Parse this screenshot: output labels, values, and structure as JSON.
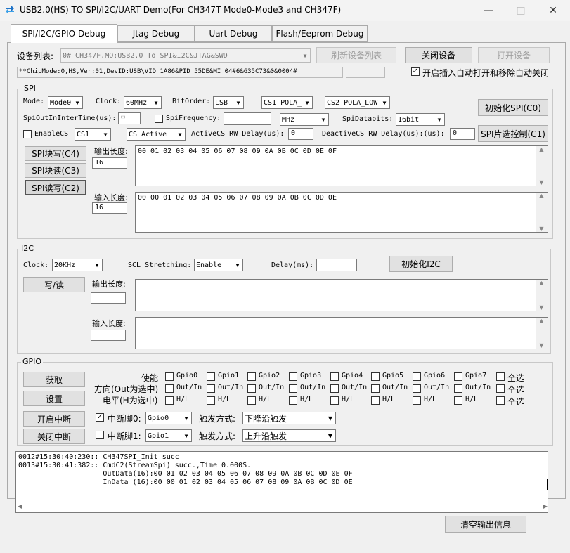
{
  "window": {
    "title": "USB2.0(HS) TO SPI/I2C/UART Demo(For CH347T Mode0-Mode3 and CH347F)",
    "minimize_icon": "minimize-icon",
    "maximize_icon": "maximize-icon",
    "close_icon": "close-icon"
  },
  "tabs": [
    {
      "label": "SPI/I2C/GPIO Debug"
    },
    {
      "label": "Jtag Debug"
    },
    {
      "label": "Uart Debug"
    },
    {
      "label": "Flash/Eeprom Debug"
    }
  ],
  "device": {
    "list_label": "设备列表:",
    "selected": "0# CH347F.MO:USB2.0 To SPI&I2C&JTAG&SWD",
    "refresh_label": "刷新设备列表",
    "close_label": "关闭设备",
    "open_label": "打开设备",
    "chip_info": "**ChipMode:0,HS,Ver:01,DevID:USB\\VID_1A86&PID_55DE&MI_04#6&635C73&0&0004#",
    "extra_value": "",
    "auto_open_label": "开启插入自动打开和移除自动关闭",
    "auto_open_checked": "✓"
  },
  "spi": {
    "group_title": "SPI",
    "mode_label": "Mode:",
    "mode_value": "Mode0",
    "clock_label": "Clock:",
    "clock_value": "60MHz",
    "bitorder_label": "BitOrder:",
    "bitorder_value": "LSB",
    "cs1_value": "CS1 POLA_",
    "cs2_value": "CS2 POLA_LOW",
    "init_label": "初始化SPI(C0)",
    "inter_time_label": "SpiOutInInterTime(us):",
    "inter_time_value": "0",
    "freq_label": "SpiFrequency:",
    "freq_value": "",
    "freq_unit": "MHz",
    "databits_label": "SpiDatabits:",
    "databits_value": "16bit",
    "enable_cs_label": "EnableCS",
    "cs_select": "CS1",
    "cs_active": "CS Active",
    "active_delay_label": "ActiveCS RW Delay(us):",
    "active_delay_value": "0",
    "deactive_delay_label": "DeactiveCS RW Delay(us):(us):",
    "deactive_delay_value": "0",
    "cs_ctrl_label": "SPI片选控制(C1)",
    "block_write_label": "SPI块写(C4)",
    "block_read_label": "SPI块读(C3)",
    "read_write_label": "SPI读写(C2)",
    "out_len_label": "输出长度:",
    "out_len_value": "16",
    "out_data": "00 01 02 03 04 05 06 07 08 09 0A 0B 0C 0D 0E 0F",
    "in_len_label": "输入长度:",
    "in_len_value": "16",
    "in_data": "00 00 01 02 03 04 05 06 07 08 09 0A 0B 0C 0D 0E"
  },
  "i2c": {
    "group_title": "I2C",
    "clock_label": "Clock:",
    "clock_value": "20KHz",
    "stretch_label": "SCL Stretching:",
    "stretch_value": "Enable",
    "delay_label": "Delay(ms):",
    "delay_value": "",
    "init_label": "初始化I2C",
    "rw_label": "写/读",
    "out_len_label": "输出长度:",
    "out_len_value": "",
    "in_len_label": "输入长度:",
    "in_len_value": ""
  },
  "gpio": {
    "group_title": "GPIO",
    "get_label": "获取",
    "set_label": "设置",
    "enable_label": "使能",
    "dir_label": "方向(Out为选中)",
    "level_label": "电平(H为选中)",
    "pins": [
      "Gpio0",
      "Gpio1",
      "Gpio2",
      "Gpio3",
      "Gpio4",
      "Gpio5",
      "Gpio6",
      "Gpio7"
    ],
    "dir_text": "Out/In",
    "level_text": "H/L",
    "select_all": "全选",
    "int_open_label": "开启中断",
    "int_close_label": "关闭中断",
    "int0_label": "中断脚0:",
    "int0_checked": "✓",
    "int0_pin": "Gpio0",
    "int1_label": "中断脚1:",
    "int1_pin": "Gpio1",
    "trigger_label": "触发方式:",
    "trigger0": "下降沿触发",
    "trigger1": "上升沿触发"
  },
  "log": {
    "lines": [
      "0012#15:30:40:230:: CH347SPI_Init succ",
      "0013#15:30:41:382:: CmdC2(StreamSpi) succ.,Time 0.000S.",
      "                    OutData(16):00 01 02 03 04 05 06 07 08 09 0A 0B 0C 0D 0E 0F",
      "                    InData (16):00 00 01 02 03 04 05 06 07 08 09 0A 0B 0C 0D 0E"
    ],
    "clear_label": "清空输出信息"
  }
}
